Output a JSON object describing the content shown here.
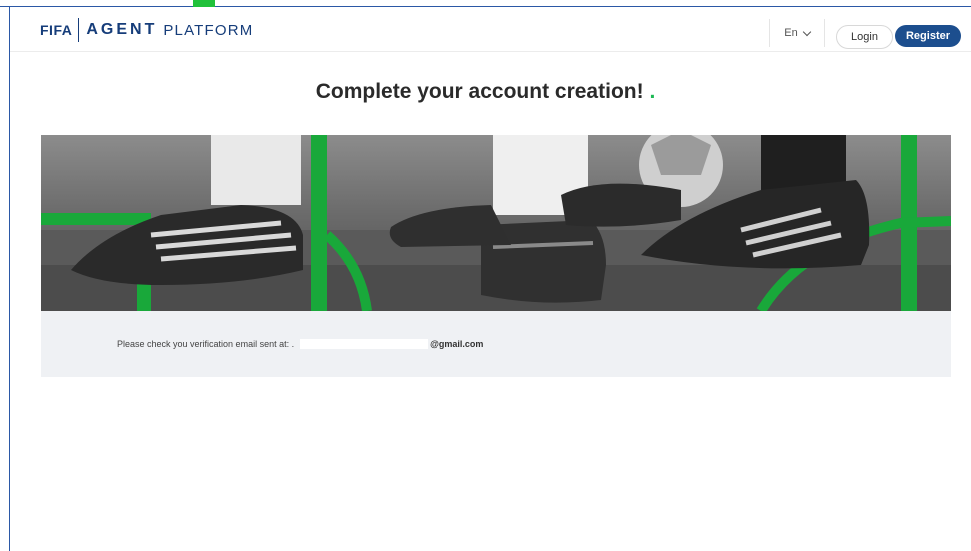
{
  "header": {
    "logo_fifa": "FIFA",
    "logo_agent": "AGENT",
    "logo_platform": "PLATFORM",
    "language": "En",
    "login_label": "Login",
    "register_label": "Register"
  },
  "main": {
    "title": "Complete your account creation!",
    "title_dot": ".",
    "verification_text": "Please check you verification email sent at: .",
    "email_domain": "@gmail.com"
  },
  "colors": {
    "brand_blue": "#1c4e8e",
    "accent_green": "#1db954",
    "panel_bg": "#eff1f4"
  },
  "icons": {
    "language_dropdown": "chevron-down-icon"
  }
}
